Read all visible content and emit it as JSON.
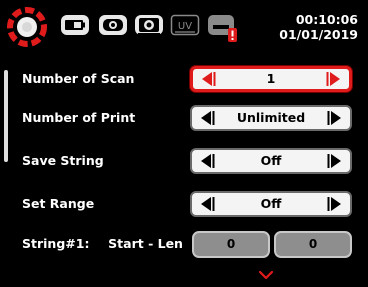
{
  "status": {
    "time": "00:10:06",
    "date": "01/01/2019"
  },
  "toolbar_icons": [
    "battery-icon",
    "scan-mode-icon",
    "camera-icon",
    "uv-icon",
    "printer-alert-icon"
  ],
  "uv_label": "UV",
  "settings": [
    {
      "label": "Number of Scan",
      "value": "1",
      "active": true
    },
    {
      "label": "Number of Print",
      "value": "Unlimited",
      "active": false
    },
    {
      "label": "Save String",
      "value": "Off",
      "active": false
    },
    {
      "label": "Set Range",
      "value": "Off",
      "active": false
    }
  ],
  "string_range": {
    "label": "String#1:",
    "sublabel": "Start - Len",
    "start": "0",
    "len": "0"
  },
  "colors": {
    "accent": "#e01b1b",
    "background": "#000000",
    "field_bg": "#f4f4f4"
  }
}
